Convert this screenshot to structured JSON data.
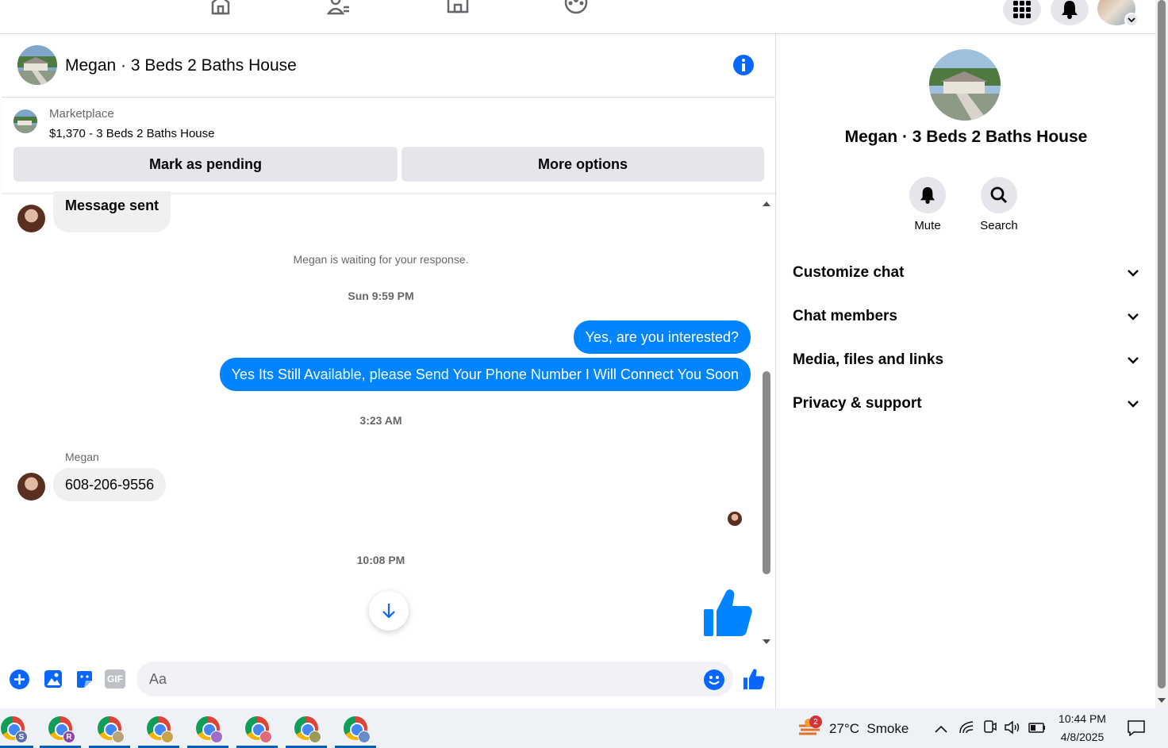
{
  "conversation": {
    "title": "Megan · 3 Beds 2 Baths House",
    "listing": {
      "source": "Marketplace",
      "title": "$1,370 - 3 Beds 2 Baths House",
      "mark_pending_label": "Mark as pending",
      "more_options_label": "More options"
    },
    "messages": {
      "msg1": "Message sent",
      "waiting": "Megan is waiting for your response.",
      "time1": "Sun 9:59 PM",
      "out1": "Yes, are you interested?",
      "out2": "Yes Its Still Available, please Send Your Phone Number I Will Connect You Soon",
      "time2": "3:23 AM",
      "sender": "Megan",
      "in2": "608-206-9556",
      "time3": "10:08 PM"
    },
    "composer": {
      "placeholder": "Aa"
    }
  },
  "info_panel": {
    "title": "Megan · 3 Beds 2 Baths House",
    "mute_label": "Mute",
    "search_label": "Search",
    "sections": [
      "Customize chat",
      "Chat members",
      "Media, files and links",
      "Privacy & support"
    ]
  },
  "taskbar": {
    "weather_badge": "2",
    "weather": "27°C  Smoke",
    "time": "10:44 PM",
    "date": "4/8/2025",
    "profiles": [
      "S",
      "R",
      "",
      "",
      "",
      "",
      "",
      ""
    ]
  },
  "colors": {
    "accent": "#0084ff",
    "brand": "#0866ff"
  }
}
